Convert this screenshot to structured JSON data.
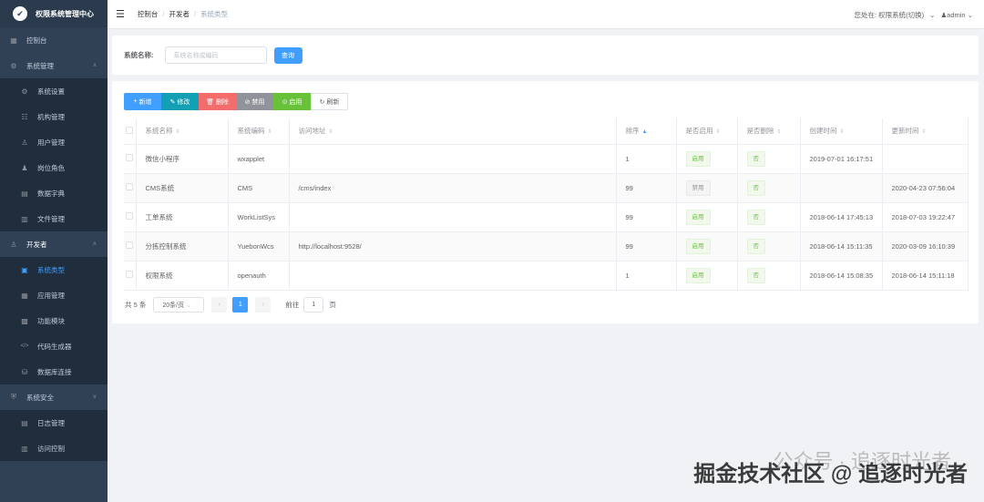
{
  "app": {
    "title": "权限系统管理中心"
  },
  "sidebar": {
    "items": [
      {
        "label": "控制台",
        "icon": "dashboard-icon"
      },
      {
        "label": "系统管理",
        "icon": "settings-icon"
      },
      {
        "label": "系统设置",
        "icon": "gear-icon"
      },
      {
        "label": "机构管理",
        "icon": "org-tree-icon"
      },
      {
        "label": "用户管理",
        "icon": "user-icon"
      },
      {
        "label": "岗位角色",
        "icon": "role-icon"
      },
      {
        "label": "数据字典",
        "icon": "dictionary-icon"
      },
      {
        "label": "文件管理",
        "icon": "file-icon"
      },
      {
        "label": "开发者",
        "icon": "developer-icon"
      },
      {
        "label": "系统类型",
        "icon": "system-type-icon"
      },
      {
        "label": "应用管理",
        "icon": "app-icon"
      },
      {
        "label": "功能模块",
        "icon": "module-icon"
      },
      {
        "label": "代码生成器",
        "icon": "code-icon"
      },
      {
        "label": "数据库连接",
        "icon": "database-icon"
      },
      {
        "label": "系统安全",
        "icon": "security-icon"
      },
      {
        "label": "日志管理",
        "icon": "log-icon"
      },
      {
        "label": "访问控制",
        "icon": "access-icon"
      }
    ]
  },
  "breadcrumb": {
    "items": [
      "控制台",
      "开发者",
      "系统类型"
    ]
  },
  "header": {
    "location_text": "您处在: 权限系统(切换)",
    "user": "admin"
  },
  "search": {
    "label": "系统名称:",
    "placeholder": "系统名称或编码",
    "button": "查询"
  },
  "toolbar": {
    "add": "新增",
    "edit": "修改",
    "delete": "删除",
    "disable": "禁用",
    "enable": "启用",
    "refresh": "刷新"
  },
  "table": {
    "headers": [
      "系统名称",
      "系统编码",
      "访问地址",
      "排序",
      "是否启用",
      "是否删除",
      "创建时间",
      "更新时间"
    ],
    "rows": [
      {
        "name": "微信小程序",
        "code": "wxapplet",
        "url": "",
        "sort": "1",
        "enabled": "启用",
        "deleted": "否",
        "created": "2019-07-01 16:17:51",
        "updated": ""
      },
      {
        "name": "CMS系统",
        "code": "CMS",
        "url": "/cms/index",
        "sort": "99",
        "enabled": "禁用",
        "deleted": "否",
        "created": "",
        "updated": "2020-04-23 07:56:04"
      },
      {
        "name": "工单系统",
        "code": "WorkListSys",
        "url": "",
        "sort": "99",
        "enabled": "启用",
        "deleted": "否",
        "created": "2018-06-14 17:45:13",
        "updated": "2018-07-03 19:22:47"
      },
      {
        "name": "分拣控制系统",
        "code": "YuebonWcs",
        "url": "http://localhost:9528/",
        "sort": "99",
        "enabled": "启用",
        "deleted": "否",
        "created": "2018-06-14 15:11:35",
        "updated": "2020-03-09 16:10:39"
      },
      {
        "name": "权限系统",
        "code": "openauth",
        "url": "",
        "sort": "1",
        "enabled": "启用",
        "deleted": "否",
        "created": "2018-06-14 15:08:35",
        "updated": "2018-06-14 15:11:18"
      }
    ]
  },
  "pagination": {
    "total": "共 5 条",
    "page_size": "20条/页",
    "current": "1",
    "goto": "前往",
    "goto_value": "1",
    "page_unit": "页"
  },
  "watermark": {
    "text1": "公众号 · 追逐时光者",
    "text2": "掘金技术社区 @ 追逐时光者"
  },
  "colors": {
    "sidebar": "#304156",
    "primary": "#409eff",
    "success": "#67c23a",
    "danger": "#f56c6c",
    "info": "#909399",
    "teal": "#13a0b4"
  }
}
